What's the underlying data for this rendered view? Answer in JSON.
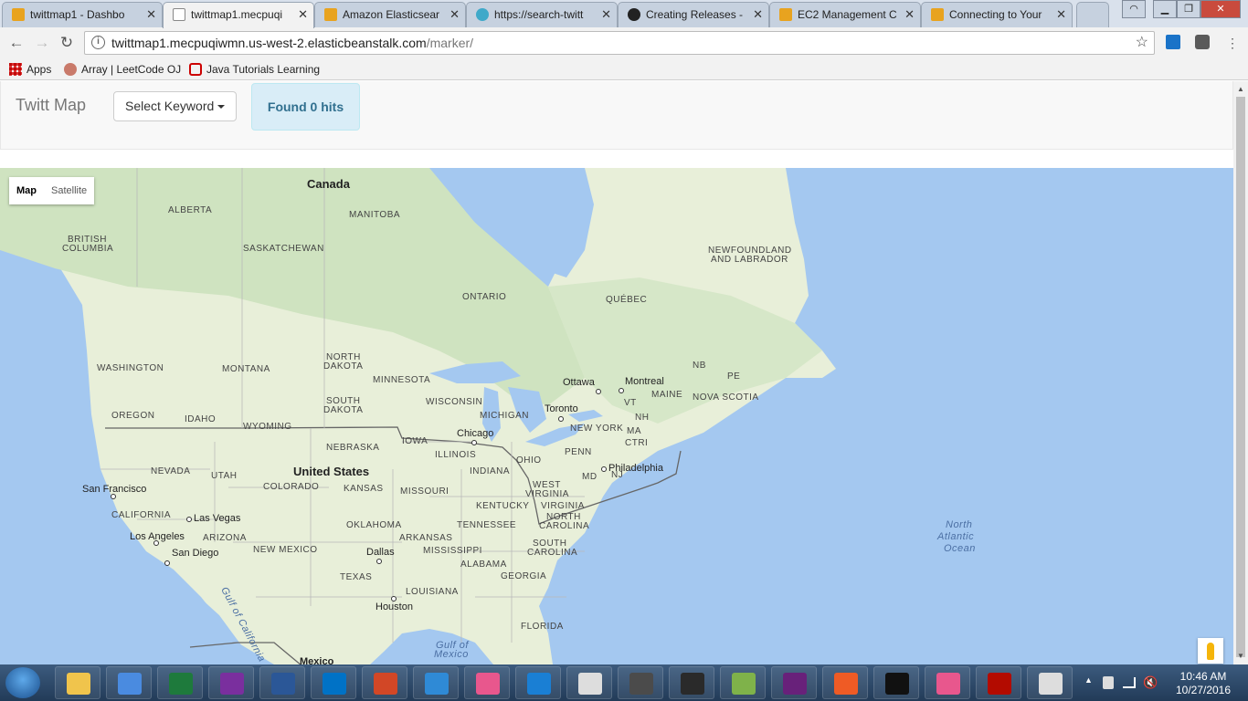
{
  "browser": {
    "tabs": [
      {
        "title": "twittmap1 - Dashbo",
        "active": false,
        "favicon_color": "#e8a31f"
      },
      {
        "title": "twittmap1.mecpuqi",
        "active": true,
        "favicon_color": "#ffffff"
      },
      {
        "title": "Amazon Elasticsear",
        "active": false,
        "favicon_color": "#e8a31f"
      },
      {
        "title": "https://search-twitt",
        "active": false,
        "favicon_color": "#3fa9c9"
      },
      {
        "title": "Creating Releases -",
        "active": false,
        "favicon_color": "#222222"
      },
      {
        "title": "EC2 Management C",
        "active": false,
        "favicon_color": "#e8a31f"
      },
      {
        "title": "Connecting to Your",
        "active": false,
        "favicon_color": "#e8a31f"
      }
    ],
    "tab_close_glyph": "✕",
    "address": {
      "host": "twittmap1.mecpuqiwmn.us-west-2.elasticbeanstalk.com",
      "path": "/marker/"
    },
    "bookmarks": [
      {
        "label": "Apps",
        "icon": "apps-grid-icon"
      },
      {
        "label": "Array | LeetCode OJ",
        "icon": "leetcode-icon"
      },
      {
        "label": "Java Tutorials Learning",
        "icon": "oracle-icon"
      }
    ]
  },
  "app": {
    "brand": "Twitt Map",
    "keyword_button": "Select Keyword",
    "hits_label": "Found 0 hits",
    "map_type": {
      "map": "Map",
      "satellite": "Satellite"
    }
  },
  "map": {
    "labels": {
      "canada": "Canada",
      "alberta": "ALBERTA",
      "british_columbia_1": "BRITISH",
      "british_columbia_2": "COLUMBIA",
      "manitoba": "MANITOBA",
      "saskatchewan": "SASKATCHEWAN",
      "ontario": "ONTARIO",
      "quebec": "QUÉBEC",
      "newfoundland_1": "NEWFOUNDLAND",
      "newfoundland_2": "AND LABRADOR",
      "washington": "WASHINGTON",
      "montana": "MONTANA",
      "north_dakota_1": "NORTH",
      "north_dakota_2": "DAKOTA",
      "minnesota": "MINNESOTA",
      "south_dakota_1": "SOUTH",
      "south_dakota_2": "DAKOTA",
      "wisconsin": "WISCONSIN",
      "michigan": "MICHIGAN",
      "oregon": "OREGON",
      "idaho": "IDAHO",
      "wyoming": "WYOMING",
      "nebraska": "NEBRASKA",
      "iowa": "IOWA",
      "illinois": "ILLINOIS",
      "indiana": "INDIANA",
      "ohio": "OHIO",
      "penn": "PENN",
      "new_york": "NEW YORK",
      "nb": "NB",
      "pe": "PE",
      "maine": "MAINE",
      "nova_scotia": "NOVA SCOTIA",
      "vt": "VT",
      "nh": "NH",
      "ma": "MA",
      "ct": "CTRI",
      "nevada": "NEVADA",
      "utah": "UTAH",
      "colorado": "COLORADO",
      "kansas": "KANSAS",
      "missouri": "MISSOURI",
      "kentucky": "KENTUCKY",
      "west_virginia_1": "WEST",
      "west_virginia_2": "VIRGINIA",
      "virginia": "VIRGINIA",
      "md": "MD",
      "nj": "NJ",
      "united_states": "United States",
      "california": "CALIFORNIA",
      "arizona": "ARIZONA",
      "new_mexico": "NEW MEXICO",
      "oklahoma": "OKLAHOMA",
      "arkansas": "ARKANSAS",
      "tennessee": "TENNESSEE",
      "north_carolina_1": "NORTH",
      "north_carolina_2": "CAROLINA",
      "south_carolina_1": "SOUTH",
      "south_carolina_2": "CAROLINA",
      "mississippi": "MISSISSIPPI",
      "alabama": "ALABAMA",
      "georgia": "GEORGIA",
      "texas": "TEXAS",
      "louisiana": "LOUISIANA",
      "florida": "FLORIDA",
      "gulf_of_california": "Gulf of California",
      "gulf_of_mexico_1": "Gulf of",
      "gulf_of_mexico_2": "Mexico",
      "north_atlantic_1": "North",
      "north_atlantic_2": "Atlantic",
      "north_atlantic_3": "Ocean",
      "mexico": "Mexico"
    },
    "cities": {
      "ottawa": "Ottawa",
      "montreal": "Montreal",
      "toronto": "Toronto",
      "chicago": "Chicago",
      "philadelphia": "Philadelphia",
      "san_francisco": "San Francisco",
      "las_vegas": "Las Vegas",
      "los_angeles": "Los Angeles",
      "san_diego": "San Diego",
      "dallas": "Dallas",
      "houston": "Houston"
    },
    "colors": {
      "water": "#a4c8f0",
      "land": "#e8efd9",
      "forest": "#cfe3c0"
    }
  },
  "taskbar": {
    "apps": [
      {
        "name": "explorer",
        "color": "#f0c44c"
      },
      {
        "name": "chrome",
        "color": "#4a8be0"
      },
      {
        "name": "excel",
        "color": "#1e7a3c"
      },
      {
        "name": "onenote",
        "color": "#7a2f9e"
      },
      {
        "name": "word",
        "color": "#2b5797"
      },
      {
        "name": "outlook",
        "color": "#0072c6"
      },
      {
        "name": "powerpoint",
        "color": "#d24726"
      },
      {
        "name": "network",
        "color": "#2f8ad6"
      },
      {
        "name": "gitkraken",
        "color": "#e8578d"
      },
      {
        "name": "teamviewer",
        "color": "#1a7fd4"
      },
      {
        "name": "eclipse-like",
        "color": "#dddddd"
      },
      {
        "name": "sublime",
        "color": "#4b4b4b"
      },
      {
        "name": "intellij",
        "color": "#2a2a2a"
      },
      {
        "name": "android-studio",
        "color": "#7fb24a"
      },
      {
        "name": "visual-studio",
        "color": "#68217a"
      },
      {
        "name": "postman",
        "color": "#ef5b25"
      },
      {
        "name": "cmd",
        "color": "#111111"
      },
      {
        "name": "gitkraken-2",
        "color": "#e8578d"
      },
      {
        "name": "acrobat",
        "color": "#b30b00"
      },
      {
        "name": "app-spinner",
        "color": "#dddddd"
      }
    ],
    "time": "10:46 AM",
    "date": "10/27/2016"
  }
}
